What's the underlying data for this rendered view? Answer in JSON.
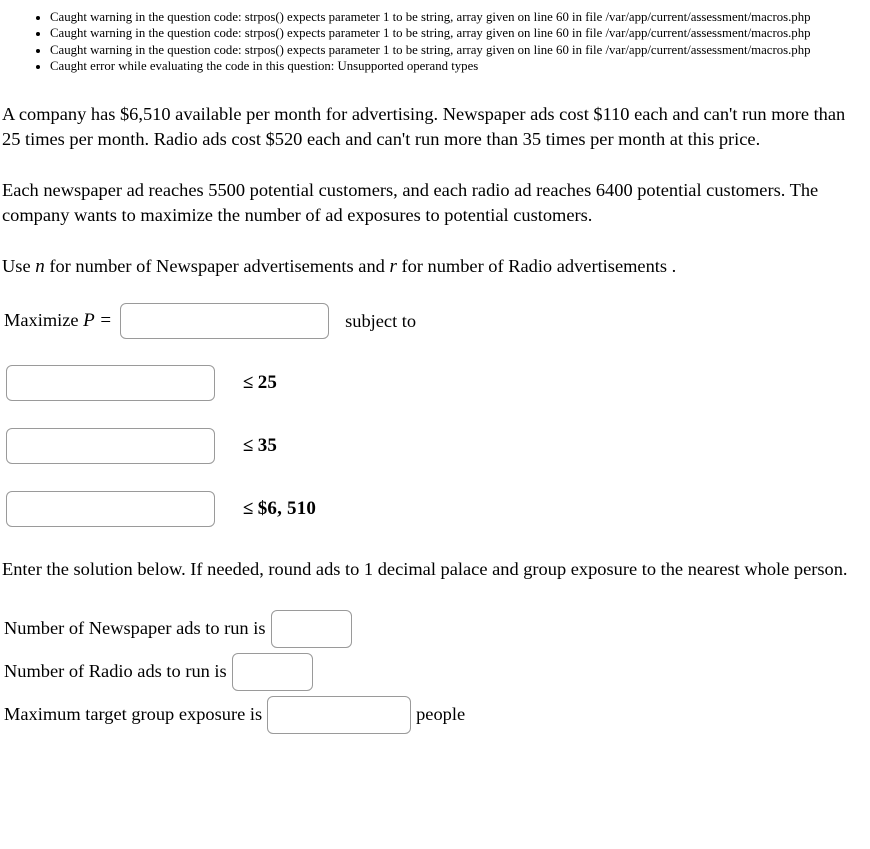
{
  "warnings": [
    "Caught warning in the question code: strpos() expects parameter 1 to be string, array given on line 60 in file /var/app/current/assessment/macros.php",
    "Caught warning in the question code: strpos() expects parameter 1 to be string, array given on line 60 in file /var/app/current/assessment/macros.php",
    "Caught warning in the question code: strpos() expects parameter 1 to be string, array given on line 60 in file /var/app/current/assessment/macros.php",
    "Caught error while evaluating the code in this question: Unsupported operand types"
  ],
  "problem": {
    "paragraph1": "A company has $6,510 available per month for advertising. Newspaper ads cost $110 each and can't run more than 25 times per month. Radio ads cost $520 each and can't run more than 35 times per month at this price.",
    "paragraph2": "Each newspaper ad reaches 5500 potential customers, and each radio ad reaches 6400 potential customers. The company wants to maximize the number of ad exposures to potential customers.",
    "variables_prefix": "Use",
    "variable_newspaper": "n",
    "variables_middle": "for number of Newspaper advertisements and",
    "variable_radio": "r",
    "variables_suffix": "for number of Radio advertisements ."
  },
  "objective": {
    "label_text": "Maximize",
    "label_var": "P",
    "label_equals": "=",
    "input_value": "",
    "input_placeholder": "",
    "subject_to": "subject to"
  },
  "constraints": [
    {
      "input_value": "",
      "relation": "≤",
      "bound": "25"
    },
    {
      "input_value": "",
      "relation": "≤",
      "bound": "35"
    },
    {
      "input_value": "",
      "relation": "≤",
      "bound": "$6, 510"
    }
  ],
  "solution": {
    "instructions": "Enter the solution below. If needed, round ads to 1 decimal palace and group exposure to the nearest whole person.",
    "rows": [
      {
        "label": "Number of Newspaper ads to run is",
        "value": "",
        "suffix": ""
      },
      {
        "label": "Number of Radio ads to run is",
        "value": "",
        "suffix": ""
      },
      {
        "label": "Maximum target group exposure is",
        "value": "",
        "suffix": "people"
      }
    ]
  }
}
